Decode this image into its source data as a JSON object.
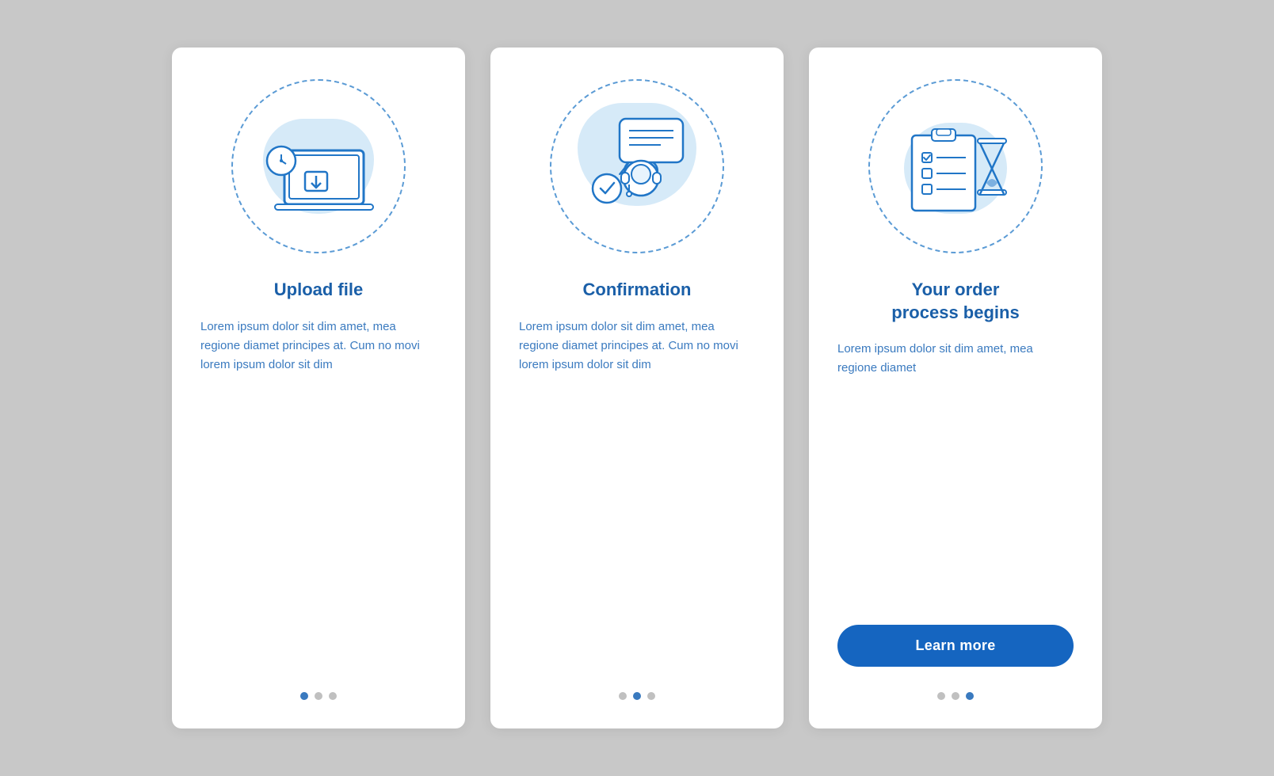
{
  "cards": [
    {
      "id": "upload-file",
      "title": "Upload file",
      "body": "Lorem ipsum dolor sit dim amet, mea regione diamet principes at. Cum no movi lorem ipsum dolor sit dim",
      "dots": [
        "active",
        "inactive",
        "inactive"
      ],
      "has_button": false
    },
    {
      "id": "confirmation",
      "title": "Confirmation",
      "body": "Lorem ipsum dolor sit dim amet, mea regione diamet principes at. Cum no movi lorem ipsum dolor sit dim",
      "dots": [
        "inactive",
        "active",
        "inactive"
      ],
      "has_button": false
    },
    {
      "id": "order-process",
      "title": "Your order\nprocess begins",
      "body": "Lorem ipsum dolor sit dim amet, mea regione diamet",
      "dots": [
        "inactive",
        "inactive",
        "active"
      ],
      "has_button": true,
      "button_label": "Learn more"
    }
  ],
  "colors": {
    "primary_blue": "#1565c0",
    "medium_blue": "#3a7abf",
    "light_blue": "#5b9bd5",
    "blob_blue": "#d6eaf8",
    "text_blue": "#1a5fa8"
  }
}
